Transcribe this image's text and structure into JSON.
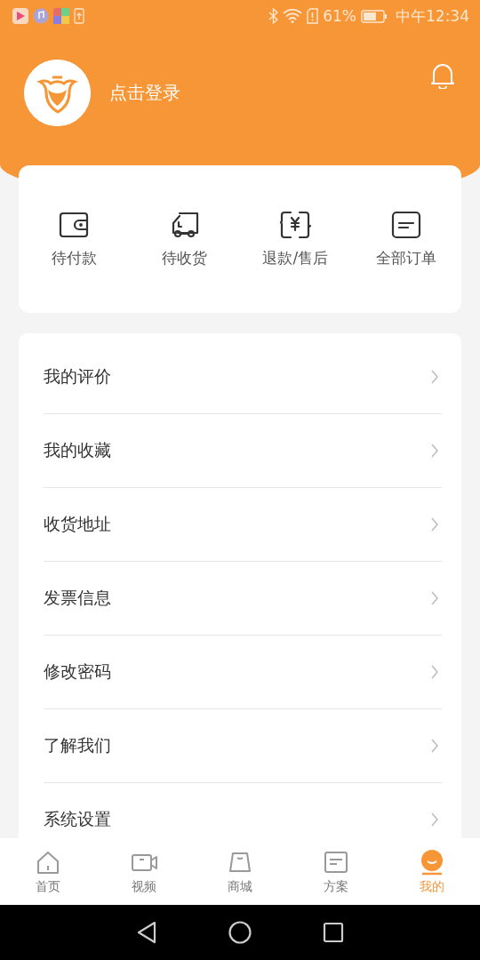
{
  "status_bar": {
    "battery_percent": "61%",
    "time": "中午12:34"
  },
  "profile": {
    "login_label": "点击登录"
  },
  "orders": [
    {
      "label": "待付款"
    },
    {
      "label": "待收货"
    },
    {
      "label": "退款/售后"
    },
    {
      "label": "全部订单"
    }
  ],
  "menu": [
    {
      "label": "我的评价"
    },
    {
      "label": "我的收藏"
    },
    {
      "label": "收货地址"
    },
    {
      "label": "发票信息"
    },
    {
      "label": "修改密码"
    },
    {
      "label": "了解我们"
    },
    {
      "label": "系统设置"
    }
  ],
  "tabs": [
    {
      "label": "首页",
      "selected": false
    },
    {
      "label": "视频",
      "selected": false
    },
    {
      "label": "商城",
      "selected": false
    },
    {
      "label": "方案",
      "selected": false
    },
    {
      "label": "我的",
      "selected": true
    }
  ]
}
